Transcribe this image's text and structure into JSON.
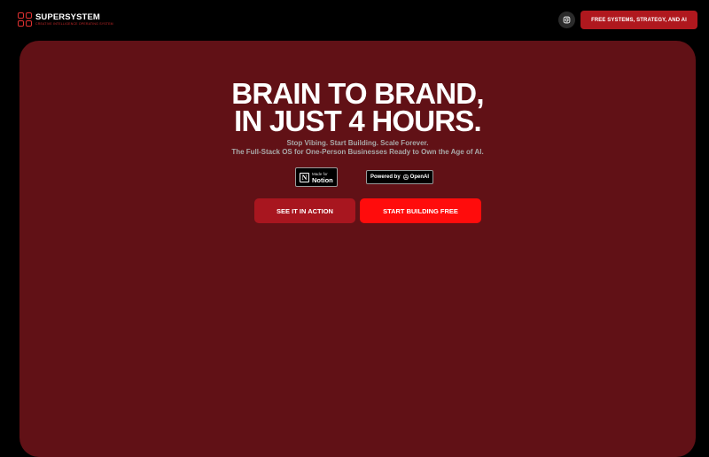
{
  "header": {
    "logo": {
      "title": "SUPERSYSTEM",
      "tagline": "CREATIVE INTELLIGENCE OPERATING SYSTEM"
    },
    "instagram_icon": "instagram-icon",
    "cta_label": "FREE SYSTEMS, STRATEGY, AND AI"
  },
  "hero": {
    "headline_line1": "BRAIN TO BRAND,",
    "headline_line2": "IN JUST 4 HOURS.",
    "subline1": "Stop Vibing. Start Building. Scale Forever.",
    "subline2": "The Full-Stack OS for One-Person Businesses Ready to Own the Age of AI.",
    "badges": {
      "notion_small": "Made for",
      "notion_big": "Notion",
      "openai_prefix": "Powered by",
      "openai_brand": "OpenAI"
    },
    "buttons": {
      "secondary": "SEE IT IN ACTION",
      "primary": "START BUILDING FREE"
    }
  },
  "colors": {
    "background": "#000000",
    "hero_bg": "#611116",
    "accent": "#ff0c0c",
    "accent_dark": "#b0181e",
    "logo_red": "#e03131"
  }
}
